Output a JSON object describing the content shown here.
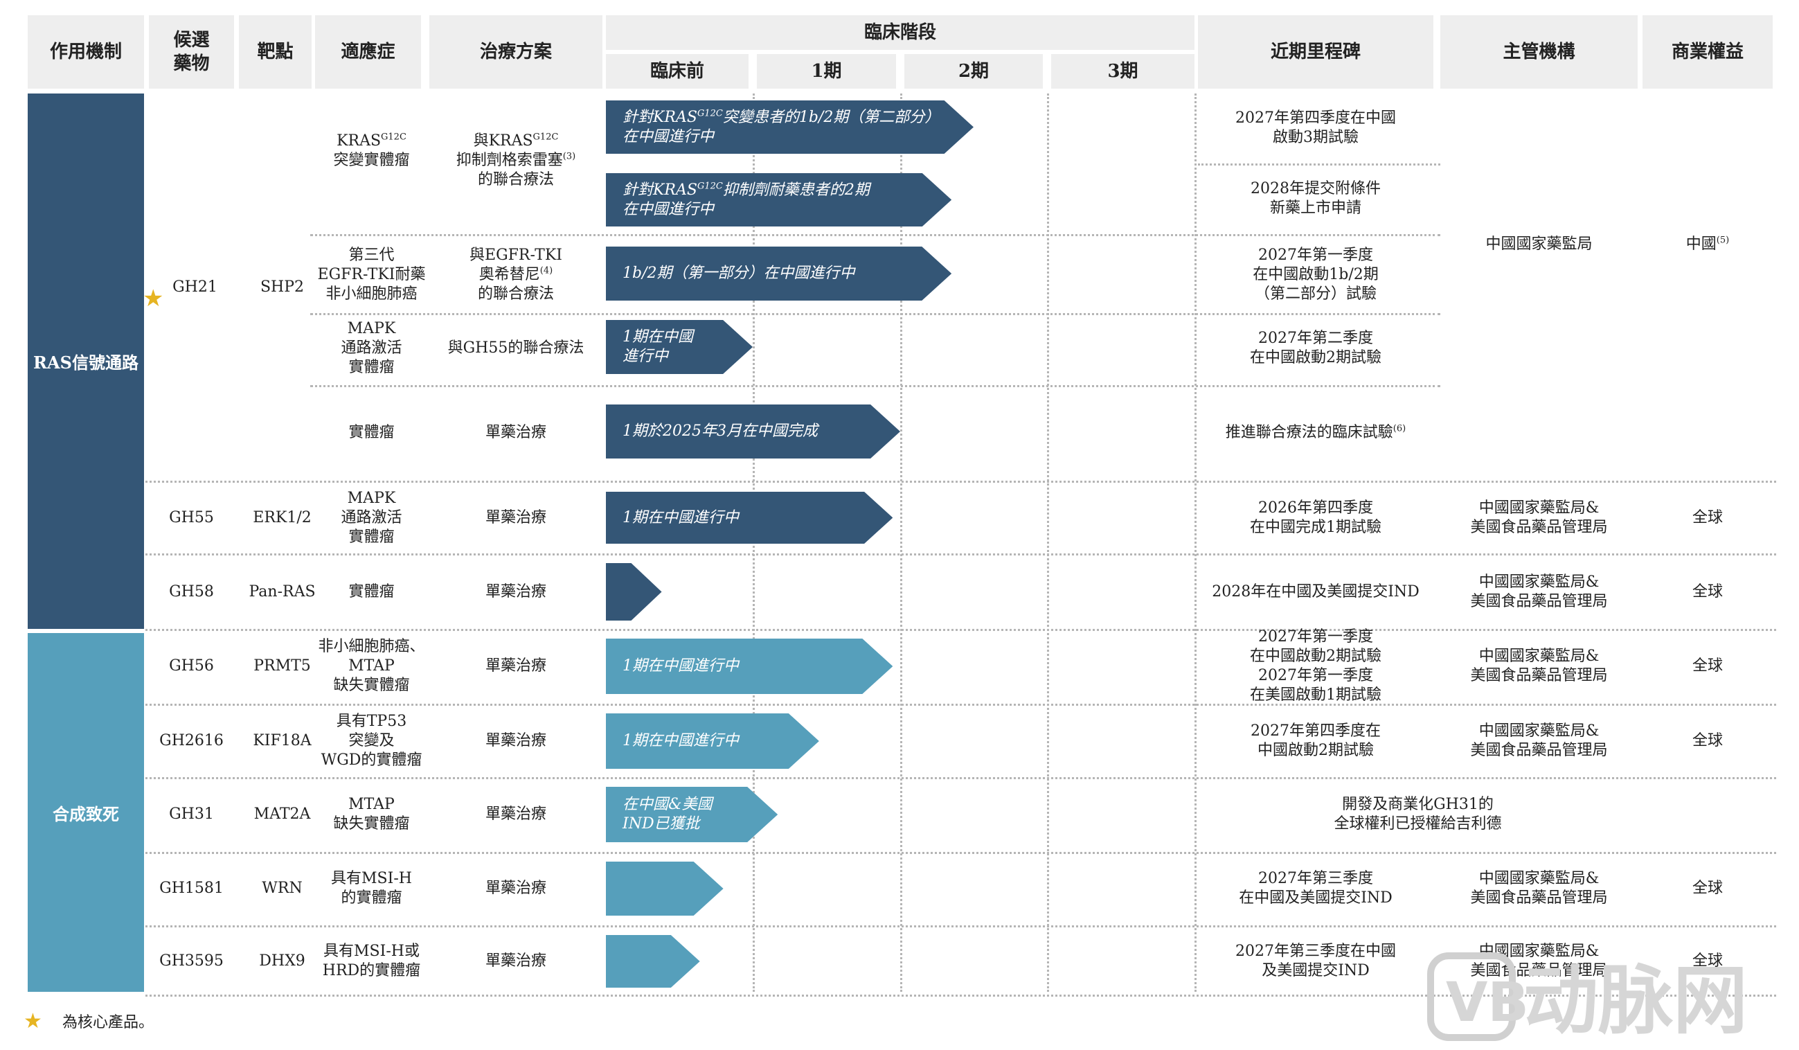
{
  "header": {
    "mechanism": "作用機制",
    "candidate": "候選\n藥物",
    "target": "靶點",
    "indication": "適應症",
    "regimen": "治療方案",
    "clinical_stage": "臨床階段",
    "stages": [
      "臨床前",
      "1期",
      "2期",
      "3期"
    ],
    "milestone": "近期里程碑",
    "authority": "主管機構",
    "rights": "商業權益"
  },
  "mechanisms": [
    {
      "label": "RAS信號通路",
      "color": "#345676"
    },
    {
      "label": "合成致死",
      "color": "#569fbb"
    }
  ],
  "gh21": {
    "candidate": "GH21",
    "target": "SHP2",
    "authority": "中國國家藥監局",
    "rights": "中國",
    "rights_sup": "(5)",
    "indications": [
      {
        "text": "KRAS",
        "sup": "G12C",
        "text2": "\n突變實體瘤"
      },
      {
        "text": "第三代\nEGFR-TKI耐藥\n非小細胞肺癌",
        "sup": "",
        "text2": ""
      },
      {
        "text": "MAPK\n通路激活\n實體瘤",
        "sup": "",
        "text2": ""
      },
      {
        "text": "實體瘤",
        "sup": "",
        "text2": ""
      }
    ],
    "regimens": [
      {
        "text": "與KRAS",
        "sup": "G12C",
        "text2": "\n抑制劑格索雷塞",
        "sup2": "(3)",
        "text3": "\n的聯合療法"
      },
      {
        "text": "與EGFR-TKI\n奧希替尼",
        "sup": "(4)",
        "text2": "\n的聯合療法",
        "sup2": "",
        "text3": ""
      },
      {
        "text": "與GH55的聯合療法",
        "sup": "",
        "text2": "",
        "sup2": "",
        "text3": ""
      },
      {
        "text": "單藥治療",
        "sup": "",
        "text2": "",
        "sup2": "",
        "text3": ""
      }
    ],
    "bars": [
      {
        "text": "針對KRAS",
        "sup": "G12C",
        "text2": "突變患者的1b/2期（第二部分）\n在中國進行中",
        "progress": 2.5
      },
      {
        "text": "針對KRAS",
        "sup": "G12C",
        "text2": "抑制劑耐藥患者的2期\n在中國進行中",
        "progress": 2.35
      },
      {
        "text": "1b/2期（第一部分）在中國進行中",
        "sup": "",
        "text2": "",
        "progress": 2.35
      },
      {
        "text": "1期在中國\n進行中",
        "sup": "",
        "text2": "",
        "progress": 1.0
      },
      {
        "text": "1期於2025年3月在中國完成",
        "sup": "",
        "text2": "",
        "progress": 2.0
      }
    ],
    "milestones": [
      {
        "text": "2027年第四季度在中國\n啟動3期試驗",
        "sup": ""
      },
      {
        "text": "2028年提交附條件\n新藥上市申請",
        "sup": ""
      },
      {
        "text": "2027年第一季度\n在中國啟動1b/2期\n（第二部分）試驗",
        "sup": ""
      },
      {
        "text": "2027年第二季度\n在中國啟動2期試驗",
        "sup": ""
      },
      {
        "text": "推進聯合療法的臨床試驗",
        "sup": "(6)"
      }
    ]
  },
  "rows": [
    {
      "candidate": "GH55",
      "target": "ERK1/2",
      "indication": "MAPK\n通路激活\n實體瘤",
      "regimen": "單藥治療",
      "bar": "1期在中國進行中",
      "progress": 1.95,
      "milestone": "2026年第四季度\n在中國完成1期試驗",
      "authority": "中國國家藥監局&\n美國食品藥品管理局",
      "rights": "全球"
    },
    {
      "candidate": "GH58",
      "target": "Pan-RAS",
      "indication": "實體瘤",
      "regimen": "單藥治療",
      "bar": "",
      "progress": 0.38,
      "milestone": "2028年在中國及美國提交IND",
      "authority": "中國國家藥監局&\n美國食品藥品管理局",
      "rights": "全球"
    },
    {
      "candidate": "GH56",
      "target": "PRMT5",
      "indication": "非小細胞肺癌、\nMTAP\n缺失實體瘤",
      "regimen": "單藥治療",
      "bar": "1期在中國進行中",
      "progress": 1.95,
      "milestone": "2027年第一季度\n在中國啟動2期試驗\n2027年第一季度\n在美國啟動1期試驗",
      "authority": "中國國家藥監局&\n美國食品藥品管理局",
      "rights": "全球"
    },
    {
      "candidate": "GH2616",
      "target": "KIF18A",
      "indication": "具有TP53\n突變及\nWGD的實體瘤",
      "regimen": "單藥治療",
      "bar": "1期在中國進行中",
      "progress": 1.45,
      "milestone": "2027年第四季度在\n中國啟動2期試驗",
      "authority": "中國國家藥監局&\n美國食品藥品管理局",
      "rights": "全球"
    },
    {
      "candidate": "GH31",
      "target": "MAT2A",
      "indication": "MTAP\n缺失實體瘤",
      "regimen": "單藥治療",
      "bar": "在中國&美國\nIND已獲批",
      "progress": 1.17,
      "milestone": "",
      "authority": "開發及商業化GH31的\n全球權利已授權給吉利德",
      "rights": ""
    },
    {
      "candidate": "GH1581",
      "target": "WRN",
      "indication": "具有MSI-H\n的實體瘤",
      "regimen": "單藥治療",
      "bar": "",
      "progress": 0.8,
      "milestone": "2027年第三季度\n在中國及美國提交IND",
      "authority": "中國國家藥監局&\n美國食品藥品管理局",
      "rights": "全球"
    },
    {
      "candidate": "GH3595",
      "target": "DHX9",
      "indication": "具有MSI-H或\nHRD的實體瘤",
      "regimen": "單藥治療",
      "bar": "",
      "progress": 0.64,
      "milestone": "2027年第三季度在中國\n及美國提交IND",
      "authority": "中國國家藥監局&\n美國食品藥品管理局",
      "rights": "全球"
    }
  ],
  "footnote": "為核心產品。",
  "watermark": "动脉网"
}
